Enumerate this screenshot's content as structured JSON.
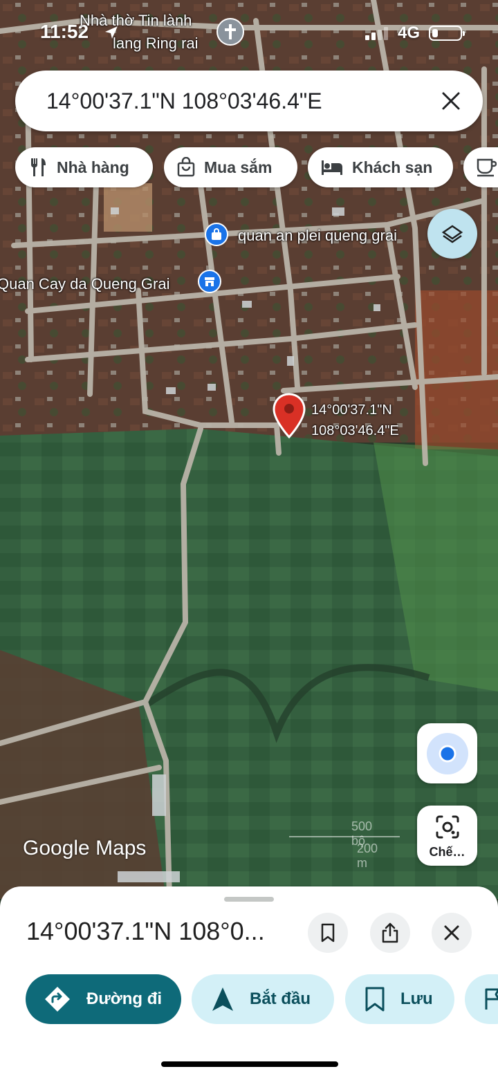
{
  "status_bar": {
    "time": "11:52",
    "network": "4G",
    "battery_level": 0.2
  },
  "search": {
    "query": "14°00'37.1\"N 108°03'46.4\"E"
  },
  "chips": [
    {
      "label": "Nhà hàng",
      "icon": "restaurant-icon"
    },
    {
      "label": "Mua sắm",
      "icon": "shopping-bag-icon"
    },
    {
      "label": "Khách sạn",
      "icon": "hotel-icon"
    },
    {
      "label": "",
      "icon": "coffee-icon"
    }
  ],
  "map": {
    "labels": {
      "church_line1": "Nhà thờ Tin lành",
      "church_line2": "lang Ring rai",
      "poi_restaurant": "quan an plei queng grai",
      "poi_store": "Quan Cay da Queng Grai"
    },
    "pin": {
      "lat": "14°00'37.1\"N",
      "lng": "108°03'46.4\"E",
      "color": "#d93025"
    },
    "attribution": "Google Maps",
    "scale": {
      "imperial": "500 bộ",
      "metric": "200 m"
    }
  },
  "controls": {
    "lens_label": "Chế…"
  },
  "sheet": {
    "title": "14°00'37.1\"N 108°0...",
    "actions": {
      "directions": "Đường đi",
      "start": "Bắt đầu",
      "save": "Lưu"
    }
  },
  "colors": {
    "primary": "#0e6a79",
    "tonal": "#d3f0f7",
    "accent_blue": "#1a73e8"
  }
}
